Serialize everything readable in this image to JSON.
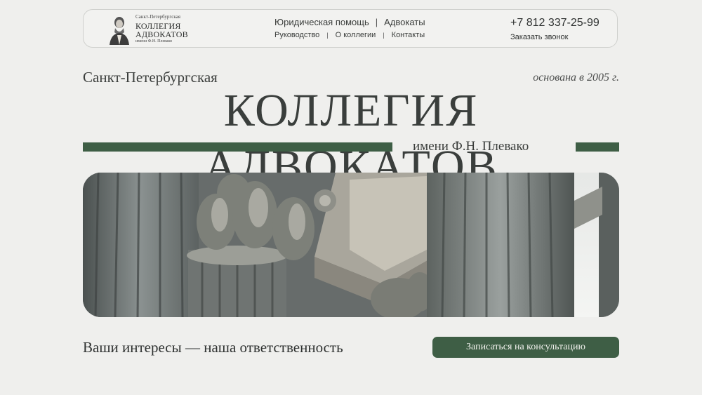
{
  "header": {
    "logo": {
      "top_text": "Санкт-Петербургская",
      "line1": "КОЛЛЕГИЯ",
      "line2": "АДВОКАТОВ",
      "bottom_text": "имени Ф.Н. Плевако"
    },
    "nav_row1": [
      "Юридическая помощь",
      "Адвокаты"
    ],
    "nav_row2": [
      "Руководство",
      "О коллегии",
      "Контакты"
    ],
    "phone": "+7 812 337-25-99",
    "callback": "Заказать звонок"
  },
  "hero": {
    "city": "Санкт-Петербургская",
    "founded": "основана в 2005 г.",
    "title": "КОЛЛЕГИЯ АДВОКАТОВ",
    "subname": "имени Ф.Н. Плевако"
  },
  "footer": {
    "slogan": "Ваши интересы — наша ответственность",
    "cta": "Записаться на консультацию"
  },
  "colors": {
    "background": "#efefed",
    "accent": "#3e5e45",
    "text": "#3a3d3b"
  }
}
